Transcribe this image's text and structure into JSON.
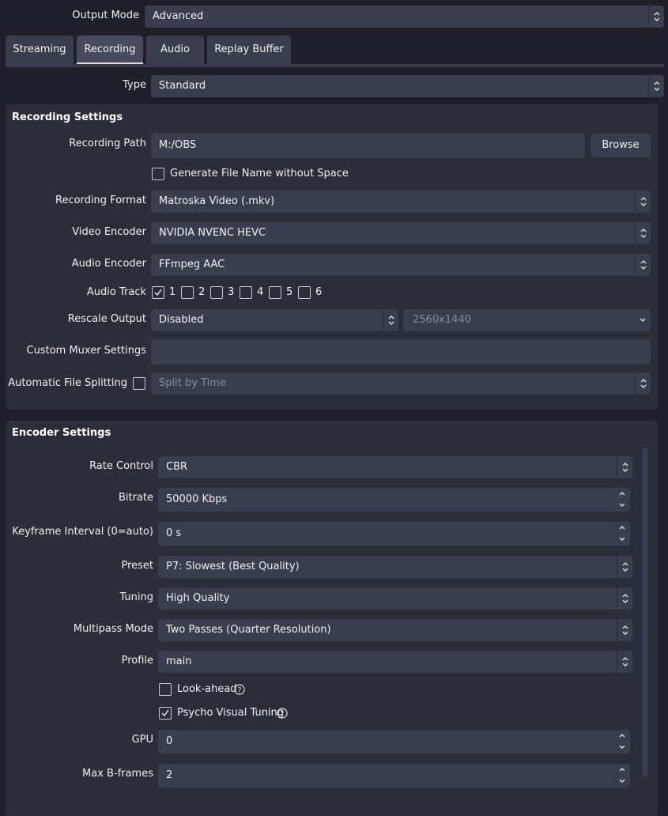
{
  "output_mode": {
    "label": "Output Mode",
    "value": "Advanced"
  },
  "tabs": [
    {
      "label": "Streaming"
    },
    {
      "label": "Recording"
    },
    {
      "label": "Audio"
    },
    {
      "label": "Replay Buffer"
    }
  ],
  "type": {
    "label": "Type",
    "value": "Standard"
  },
  "recording_settings": {
    "title": "Recording Settings",
    "path_label": "Recording Path",
    "path_value": "M:/OBS",
    "browse_label": "Browse",
    "gen_filename_label": "Generate File Name without Space",
    "format_label": "Recording Format",
    "format_value": "Matroska Video (.mkv)",
    "video_encoder_label": "Video Encoder",
    "video_encoder_value": "NVIDIA NVENC HEVC",
    "audio_encoder_label": "Audio Encoder",
    "audio_encoder_value": "FFmpeg AAC",
    "audio_track_label": "Audio Track",
    "tracks": [
      "1",
      "2",
      "3",
      "4",
      "5",
      "6"
    ],
    "rescale_label": "Rescale Output",
    "rescale_value": "Disabled",
    "rescale_resolution": "2560x1440",
    "muxer_label": "Custom Muxer Settings",
    "muxer_value": "",
    "split_label": "Automatic File Splitting",
    "split_value": "Split by Time"
  },
  "encoder_settings": {
    "title": "Encoder Settings",
    "rate_control_label": "Rate Control",
    "rate_control_value": "CBR",
    "bitrate_label": "Bitrate",
    "bitrate_value": "50000 Kbps",
    "keyframe_label": "Keyframe Interval (0=auto)",
    "keyframe_value": "0 s",
    "preset_label": "Preset",
    "preset_value": "P7: Slowest (Best Quality)",
    "tuning_label": "Tuning",
    "tuning_value": "High Quality",
    "multipass_label": "Multipass Mode",
    "multipass_value": "Two Passes (Quarter Resolution)",
    "profile_label": "Profile",
    "profile_value": "main",
    "lookahead_label": "Look-ahead",
    "psycho_label": "Psycho Visual Tuning",
    "gpu_label": "GPU",
    "gpu_value": "0",
    "bframes_label": "Max B-frames",
    "bframes_value": "2"
  },
  "colors": {
    "background": "#1e1f29",
    "panel": "#2b2e38",
    "field": "#3a3d4d",
    "text": "#f0f0f0"
  }
}
